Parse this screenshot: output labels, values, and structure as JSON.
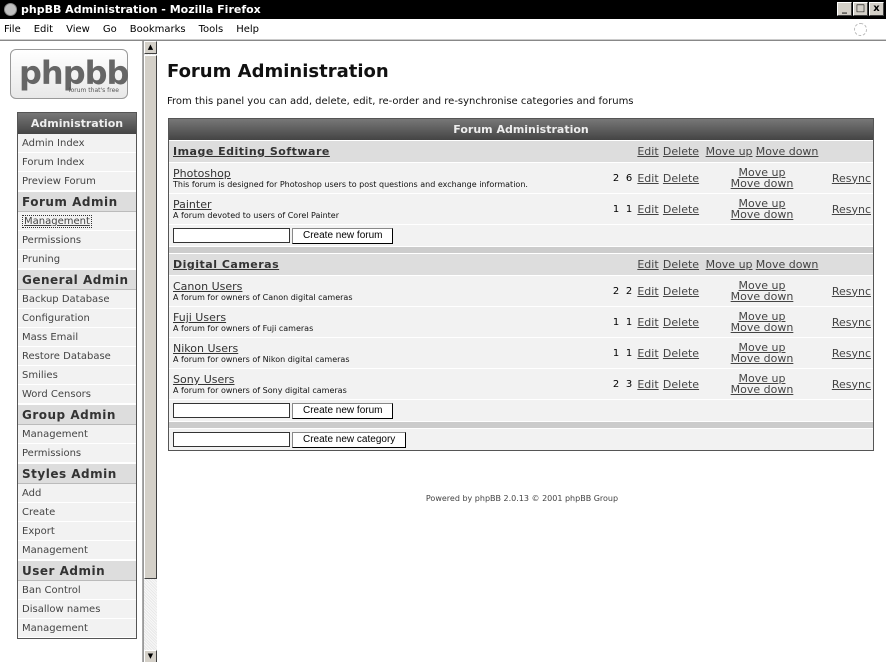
{
  "window": {
    "title": "phpBB Administration - Mozilla Firefox",
    "buttons": [
      "_",
      "□",
      "x"
    ]
  },
  "menubar": {
    "items": [
      "File",
      "Edit",
      "View",
      "Go",
      "Bookmarks",
      "Tools",
      "Help"
    ]
  },
  "logo": {
    "word": "phpbb",
    "tagline": "forum that's free"
  },
  "nav": {
    "header": "Administration",
    "top_items": [
      "Admin Index",
      "Forum Index",
      "Preview Forum"
    ],
    "sections": [
      {
        "title": "Forum Admin",
        "items": [
          "Management",
          "Permissions",
          "Pruning"
        ]
      },
      {
        "title": "General Admin",
        "items": [
          "Backup Database",
          "Configuration",
          "Mass Email",
          "Restore Database",
          "Smilies",
          "Word Censors"
        ]
      },
      {
        "title": "Group Admin",
        "items": [
          "Management",
          "Permissions"
        ]
      },
      {
        "title": "Styles Admin",
        "items": [
          "Add",
          "Create",
          "Export",
          "Management"
        ]
      },
      {
        "title": "User Admin",
        "items": [
          "Ban Control",
          "Disallow names",
          "Management"
        ]
      }
    ]
  },
  "page": {
    "title": "Forum Administration",
    "description": "From this panel you can add, delete, edit, re-order and re-synchronise categories and forums"
  },
  "table": {
    "header": "Forum Administration",
    "labels": {
      "edit": "Edit",
      "delete": "Delete",
      "move_up": "Move up",
      "move_down": "Move down",
      "resync": "Resync",
      "create_forum": "Create new forum",
      "create_category": "Create new category"
    },
    "categories": [
      {
        "name": "Image Editing Software",
        "forums": [
          {
            "name": "Photoshop",
            "desc": "This forum is designed for Photoshop users to post questions and exchange information.",
            "topics": "2",
            "posts": "6"
          },
          {
            "name": "Painter",
            "desc": "A forum devoted to users of Corel Painter",
            "topics": "1",
            "posts": "1"
          }
        ]
      },
      {
        "name": "Digital Cameras",
        "forums": [
          {
            "name": "Canon Users",
            "desc": "A forum for owners of Canon digital cameras",
            "topics": "2",
            "posts": "2"
          },
          {
            "name": "Fuji Users",
            "desc": "A forum for owners of Fuji cameras",
            "topics": "1",
            "posts": "1"
          },
          {
            "name": "Nikon Users",
            "desc": "A forum for owners of Nikon digital cameras",
            "topics": "1",
            "posts": "1"
          },
          {
            "name": "Sony Users",
            "desc": "A forum for owners of Sony digital cameras",
            "topics": "2",
            "posts": "3"
          }
        ]
      }
    ]
  },
  "footer": "Powered by phpBB 2.0.13 © 2001 phpBB Group"
}
